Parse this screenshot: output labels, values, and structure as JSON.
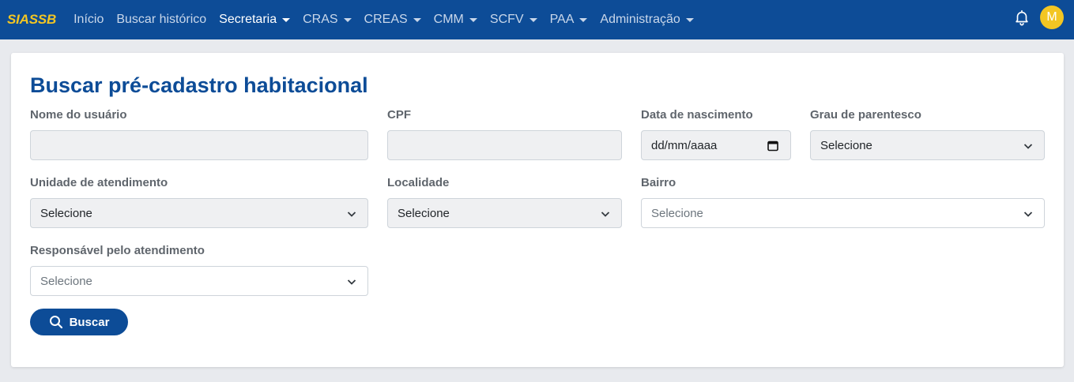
{
  "nav": {
    "brand": "SIASSB",
    "items": [
      {
        "label": "Início",
        "dropdown": false,
        "active": false
      },
      {
        "label": "Buscar histórico",
        "dropdown": false,
        "active": false
      },
      {
        "label": "Secretaria",
        "dropdown": true,
        "active": true
      },
      {
        "label": "CRAS",
        "dropdown": true,
        "active": false
      },
      {
        "label": "CREAS",
        "dropdown": true,
        "active": false
      },
      {
        "label": "CMM",
        "dropdown": true,
        "active": false
      },
      {
        "label": "SCFV",
        "dropdown": true,
        "active": false
      },
      {
        "label": "PAA",
        "dropdown": true,
        "active": false
      },
      {
        "label": "Administração",
        "dropdown": true,
        "active": false
      }
    ],
    "avatar_initial": "M",
    "notification_icon": "bell-icon"
  },
  "page": {
    "title": "Buscar pré-cadastro habitacional"
  },
  "form": {
    "nome_label": "Nome do usuário",
    "nome_value": "",
    "cpf_label": "CPF",
    "cpf_value": "",
    "nascimento_label": "Data de nascimento",
    "nascimento_placeholder": "dd/mm/aaaa",
    "grau_label": "Grau de parentesco",
    "grau_value": "Selecione",
    "unidade_label": "Unidade de atendimento",
    "unidade_value": "Selecione",
    "localidade_label": "Localidade",
    "localidade_value": "Selecione",
    "bairro_label": "Bairro",
    "bairro_value": "Selecione",
    "responsavel_label": "Responsável pelo atendimento",
    "responsavel_value": "Selecione",
    "submit_label": "Buscar"
  },
  "colors": {
    "primary": "#0d4c97",
    "brand_accent": "#f3c623"
  }
}
